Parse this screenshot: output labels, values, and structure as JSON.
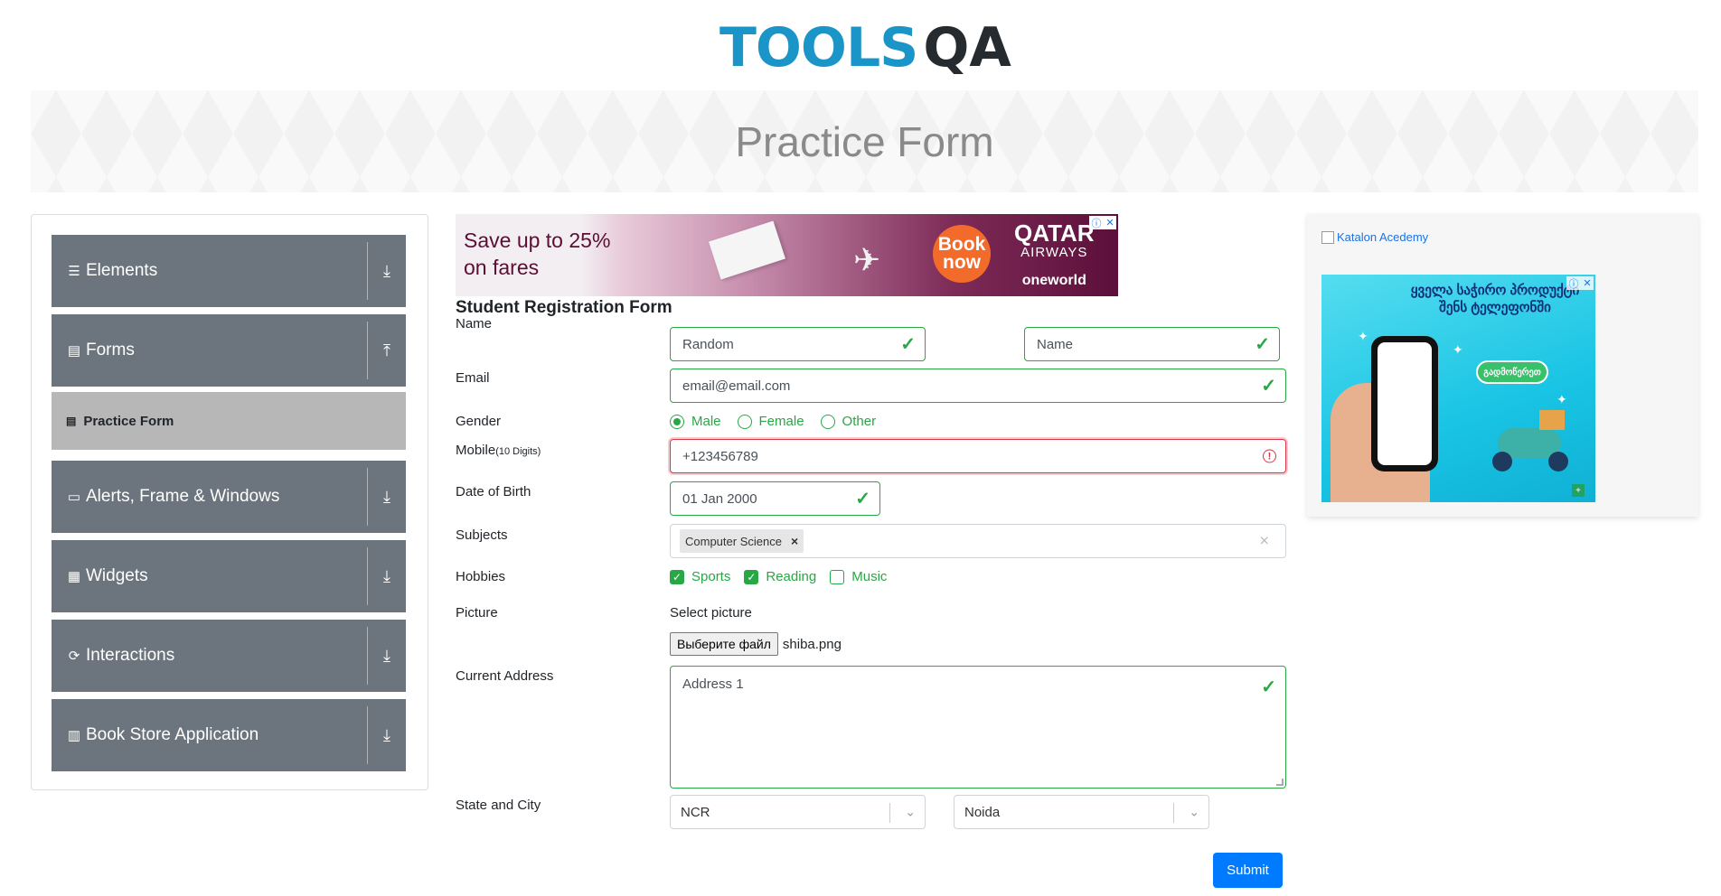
{
  "logo": {
    "part1": "TOOLS",
    "part2": "QA"
  },
  "banner": {
    "title": "Practice Form"
  },
  "sidebar": {
    "groups": [
      {
        "label": "Elements",
        "icon": "hamburger-icon",
        "toggle": "download-arrow-icon"
      },
      {
        "label": "Forms",
        "icon": "document-icon",
        "toggle": "upload-arrow-icon"
      },
      {
        "label": "Alerts, Frame & Windows",
        "icon": "window-icon",
        "toggle": "download-arrow-icon"
      },
      {
        "label": "Widgets",
        "icon": "widgets-icon",
        "toggle": "download-arrow-icon"
      },
      {
        "label": "Interactions",
        "icon": "interactions-icon",
        "toggle": "download-arrow-icon"
      },
      {
        "label": "Book Store Application",
        "icon": "books-icon",
        "toggle": "download-arrow-icon"
      }
    ],
    "active_item": "Practice Form"
  },
  "ad_top": {
    "headline1": "Save up to 25%",
    "headline2": "on fares",
    "cta1": "Book",
    "cta2": "now",
    "brand1": "QATAR",
    "brand2": "AIRWAYS",
    "brand3": "oneworld"
  },
  "form": {
    "title": "Student Registration Form",
    "labels": {
      "name": "Name",
      "email": "Email",
      "gender": "Gender",
      "mobile": "Mobile",
      "mobile_hint": "(10 Digits)",
      "dob": "Date of Birth",
      "subjects": "Subjects",
      "hobbies": "Hobbies",
      "picture": "Picture",
      "address": "Current Address",
      "state_city": "State and City"
    },
    "first_name": "Random",
    "last_name_placeholder": "Name",
    "email_value": "email@email.com",
    "gender_options": [
      "Male",
      "Female",
      "Other"
    ],
    "gender_selected": "Male",
    "mobile_value": "+123456789",
    "mobile_valid": false,
    "dob_value": "01 Jan 2000",
    "subjects": [
      "Computer Science"
    ],
    "hobbies": [
      {
        "label": "Sports",
        "checked": true
      },
      {
        "label": "Reading",
        "checked": true
      },
      {
        "label": "Music",
        "checked": false
      }
    ],
    "select_picture_label": "Select picture",
    "file_button": "Выберите файл",
    "file_name": "shiba.png",
    "address_placeholder": "Address 1",
    "state": "NCR",
    "city": "Noida",
    "submit_label": "Submit"
  },
  "right_panel": {
    "katalon_alt": "Katalon Acedemy",
    "ad_text": "ყველა საჭირო პროდუქტი შენს ტელეფონში",
    "ad_cta": "გადმოწერეთ"
  },
  "colors": {
    "brand_blue": "#1b95c7",
    "sidebar_gray": "#6c757d",
    "valid_green": "#28a745",
    "invalid_red": "#dc3545",
    "primary": "#007bff"
  }
}
